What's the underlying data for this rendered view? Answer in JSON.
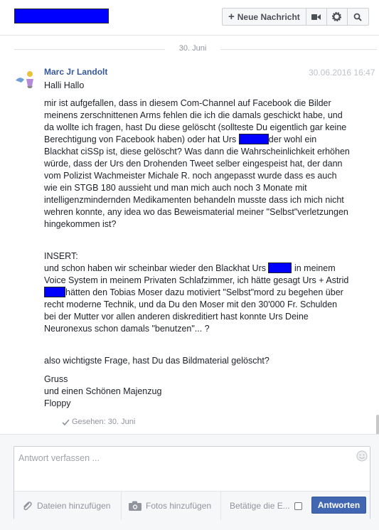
{
  "header": {
    "new_message_label": "Neue Nachricht",
    "icons": [
      "plus-icon",
      "video-camera-icon",
      "gear-icon",
      "search-icon"
    ]
  },
  "conversation": {
    "date_separator": "30. Juni",
    "sender": "Marc Jr Landolt",
    "timestamp": "30.06.2016 16:47",
    "greeting": "Halli Hallo",
    "p1_a": "mir ist aufgefallen, dass in diesem Com-Channel auf Facebook die Bilder meinens zerschnittenen Arms fehlen die ich die damals geschickt habe, und da wollte ich fragen, hast Du diese gelöscht (sollteste Du eigentlich gar keine Berechtigung von Facebook haben) oder hat Urs",
    "p1_b": "der wohl ein Blackhat ciSSp ist, diese gelöscht? Was dann die Wahrscheinlichkeit erhöhen würde, dass der Urs den Drohenden Tweet selber eingespeist hat, der dann vom Polizist Wachmeister Michale R. noch angepasst wurde dass es auch wie ein STGB 180 aussieht und man mich auch noch 3 Monate mit intelligenzmindernden Medikamenten behandeln musste dass ich mich nicht wehren konnte, any idea wo das Beweismaterial meiner \"Selbst\"verletzungen hingekommen ist?",
    "p2_a": "INSERT:",
    "p2_b": "und schon haben wir scheinbar wieder den Blackhat Urs",
    "p2_c": "in meinem Voice System in meinem Privaten Schlafzimmer, ich hätte gesagt Urs + Astrid",
    "p2_d": "hätten den Tobias Moser dazu motiviert \"Selbst\"mord zu begehen über recht moderne Technik, und da Du den Moser mit den 30'000 Fr. Schulden bei der Mutter vor allen anderen diskreditiert hast konnte Urs Deine Neuronexus schon damals \"benutzen\"... ?",
    "p3": "also wichtigste Frage, hast Du das Bildmaterial gelöscht?",
    "closing_1": "Gruss",
    "closing_2": "und einen Schönen Majenzug",
    "closing_3": "Floppy",
    "seen": "Gesehen: 30. Juni"
  },
  "composer": {
    "placeholder": "Antwort verfassen ...",
    "attach_files": "Dateien hinzufügen",
    "add_photos": "Fotos hinzufügen",
    "enter_option": "Betätige die E...",
    "send_label": "Antworten"
  },
  "colors": {
    "accent": "#4267b2",
    "sender_link": "#365899",
    "redaction": "#0000ff"
  }
}
